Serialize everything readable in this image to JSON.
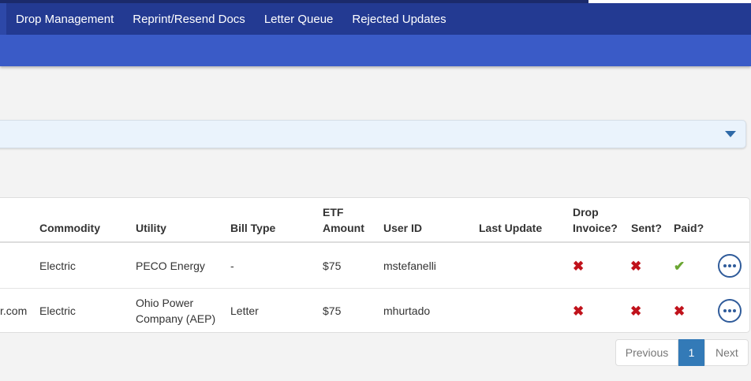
{
  "nav": {
    "items": [
      {
        "label": "Drop Management"
      },
      {
        "label": "Reprint/Resend Docs"
      },
      {
        "label": "Letter Queue"
      },
      {
        "label": "Rejected Updates"
      }
    ]
  },
  "filter_panel": {
    "toggle_icon": "caret-down-icon"
  },
  "table": {
    "headers": {
      "commodity": "Commodity",
      "utility": "Utility",
      "bill_type": "Bill Type",
      "etf_line1": "ETF",
      "etf_line2": "Amount",
      "user_id": "User ID",
      "last_update": "Last Update",
      "drop_line1": "Drop",
      "drop_line2": "Invoice?",
      "sent": "Sent?",
      "paid": "Paid?"
    },
    "rows": [
      {
        "truncated_left": "",
        "commodity": "Electric",
        "utility_line1": "PECO Energy",
        "utility_line2": "",
        "bill_type": "-",
        "etf_amount": "$75",
        "user_id": "mstefanelli",
        "last_update": "",
        "drop_invoice": "✖",
        "sent": "✖",
        "paid": "✔"
      },
      {
        "truncated_left": "r.com",
        "commodity": "Electric",
        "utility_line1": "Ohio Power",
        "utility_line2": "Company (AEP)",
        "bill_type": "Letter",
        "etf_amount": "$75",
        "user_id": "mhurtado",
        "last_update": "",
        "drop_invoice": "✖",
        "sent": "✖",
        "paid": "✖"
      }
    ],
    "status_colors": {
      "no": "#c0121b",
      "yes": "#6aa632"
    }
  },
  "pagination": {
    "previous": "Previous",
    "current": "1",
    "next": "Next"
  },
  "colors": {
    "nav_bg": "#233a92",
    "subbar_bg": "#3a5bc7",
    "accent": "#337ab7"
  }
}
